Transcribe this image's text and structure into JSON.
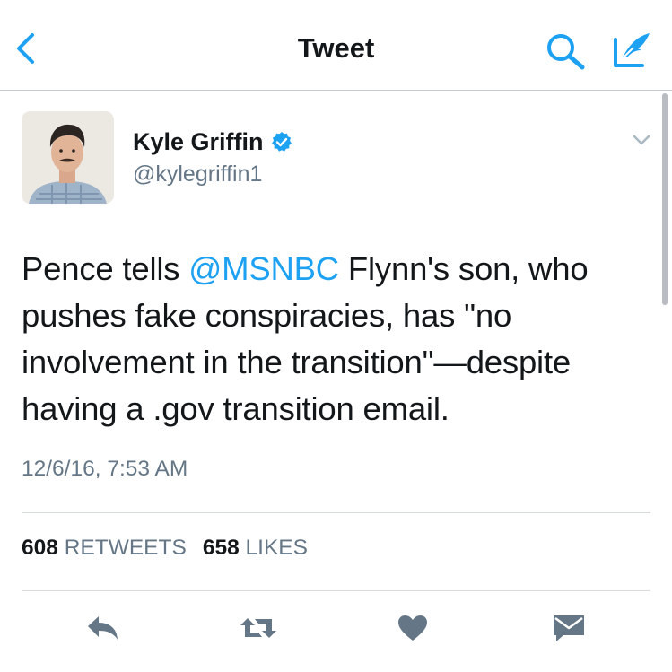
{
  "nav": {
    "title": "Tweet",
    "back_icon": "chevron-left-icon",
    "search_icon": "search-icon",
    "compose_icon": "compose-icon",
    "accent_color": "#1da1f2"
  },
  "tweet": {
    "author_name": "Kyle Griffin",
    "author_handle": "@kylegriffin1",
    "verified": true,
    "text_before_mention": "Pence tells ",
    "mention": "@MSNBC",
    "text_after_mention": " Flynn's son, who pushes fake conspiracies, has \"no involvement in the transition\"—despite having a .gov transition email.",
    "timestamp": "12/6/16, 7:53 AM"
  },
  "stats": {
    "retweets_count": "608",
    "retweets_label": "RETWEETS",
    "likes_count": "658",
    "likes_label": "LIKES"
  },
  "actions": {
    "reply_icon": "reply-icon",
    "retweet_icon": "retweet-icon",
    "like_icon": "heart-icon",
    "dm_icon": "envelope-icon",
    "icon_color": "#657786"
  }
}
